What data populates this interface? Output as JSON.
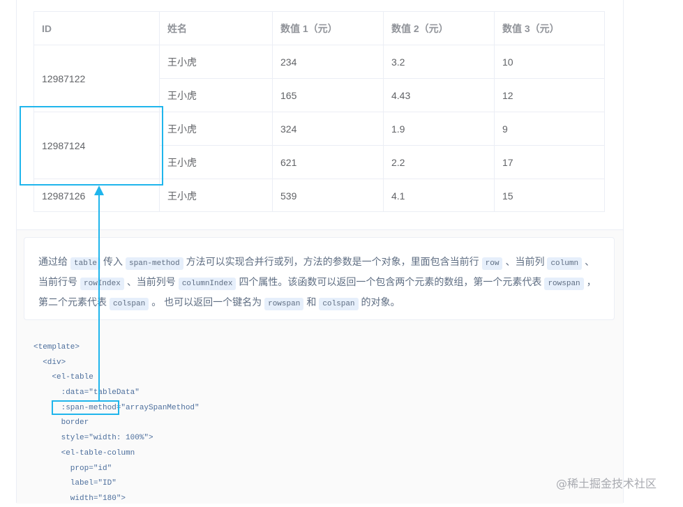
{
  "table": {
    "headers": [
      "ID",
      "姓名",
      "数值 1（元）",
      "数值 2（元）",
      "数值 3（元）"
    ],
    "rows": [
      {
        "id": "12987122",
        "name": "王小虎",
        "v1": "234",
        "v2": "3.2",
        "v3": "10"
      },
      {
        "id": "12987122",
        "name": "王小虎",
        "v1": "165",
        "v2": "4.43",
        "v3": "12"
      },
      {
        "id": "12987124",
        "name": "王小虎",
        "v1": "324",
        "v2": "1.9",
        "v3": "9"
      },
      {
        "id": "12987124",
        "name": "王小虎",
        "v1": "621",
        "v2": "2.2",
        "v3": "17"
      },
      {
        "id": "12987126",
        "name": "王小虎",
        "v1": "539",
        "v2": "4.1",
        "v3": "15"
      }
    ]
  },
  "description": {
    "t1": "通过给",
    "c1": "table",
    "t2": "传入",
    "c2": "span-method",
    "t3": "方法可以实现合并行或列，方法的参数是一个对象，里面包含当前行",
    "c3": "row",
    "t4": "、当前列",
    "c4": "column",
    "t5": "、当前行号",
    "c5": "rowIndex",
    "t6": "、当前列号",
    "c6": "columnIndex",
    "t7": "四个属性。该函数可以返回一个包含两个元素的数组，第一个元素代表",
    "c7": "rowspan",
    "t8": "，第二个元素代表",
    "c8": "colspan",
    "t9": "。 也可以返回一个键名为",
    "c9": "rowspan",
    "t10": "和",
    "c10": "colspan",
    "t11": "的对象。"
  },
  "code_lines": [
    "<template>",
    "  <div>",
    "    <el-table",
    "      :data=\"tableData\"",
    "      :span-method=\"arraySpanMethod\"",
    "      border",
    "      style=\"width: 100%\">",
    "      <el-table-column",
    "        prop=\"id\"",
    "        label=\"ID\"",
    "        width=\"180\">"
  ],
  "watermark": "@稀土掘金技术社区",
  "colors": {
    "highlight": "#1fb5ec",
    "accent": "#409eff"
  }
}
